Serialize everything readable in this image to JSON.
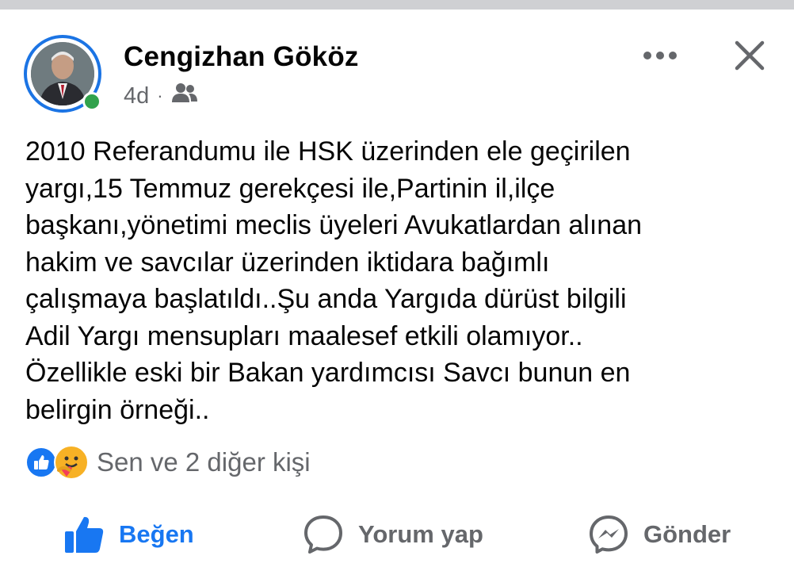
{
  "post": {
    "author": "Cengizhan Gököz",
    "time": "4d",
    "separator": "·",
    "audience_icon": "friends-icon",
    "text": "2010 Referandumu ile HSK üzerinden ele geçirilen\nyargı,15 Temmuz gerekçesi ile,Partinin il,ilçe\nbaşkanı,yönetimi  meclis üyeleri Avukatlardan alınan\nhakim ve savcılar üzerinden iktidara bağımlı\nçalışmaya başlatıldı..Şu anda Yargıda dürüst bilgili\nAdil Yargı mensupları maalesef etkili olamıyor..\nÖzellikle eski bir Bakan yardımcısı Savcı bunun en\nbelirgin örneği.."
  },
  "reactions": {
    "icons": [
      "like-reaction-icon",
      "care-reaction-icon"
    ],
    "summary": "Sen ve 2 diğer kişi"
  },
  "actions": {
    "like": "Beğen",
    "comment": "Yorum yap",
    "send": "Gönder"
  },
  "colors": {
    "accent": "#1877f2",
    "secondary_text": "#65676b",
    "online": "#31a24c"
  }
}
